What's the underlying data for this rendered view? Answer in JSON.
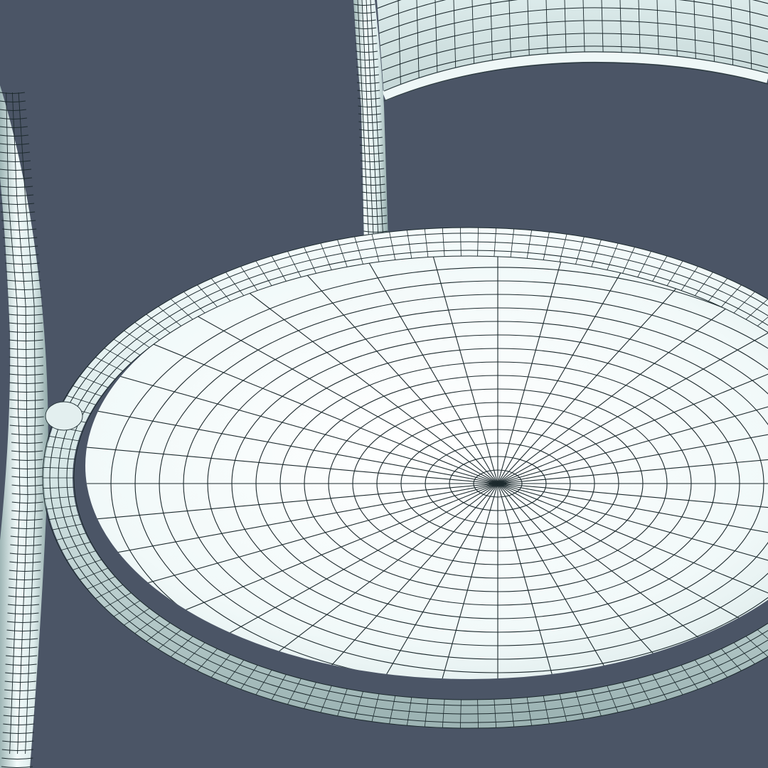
{
  "viewport": {
    "background_color": "#4b5566",
    "render_style": "wireframe-on-shaded"
  },
  "model": {
    "surface_color": "#eef7f7",
    "surface_shade_color": "#c6d9d9",
    "edge_color": "#1d2a2e",
    "parts": [
      {
        "id": "backrest",
        "kind": "curved-panel"
      },
      {
        "id": "back-left-leg",
        "kind": "tube"
      },
      {
        "id": "front-left-leg",
        "kind": "tube"
      },
      {
        "id": "seat",
        "kind": "disc"
      },
      {
        "id": "seat-rim",
        "kind": "torus"
      }
    ]
  }
}
